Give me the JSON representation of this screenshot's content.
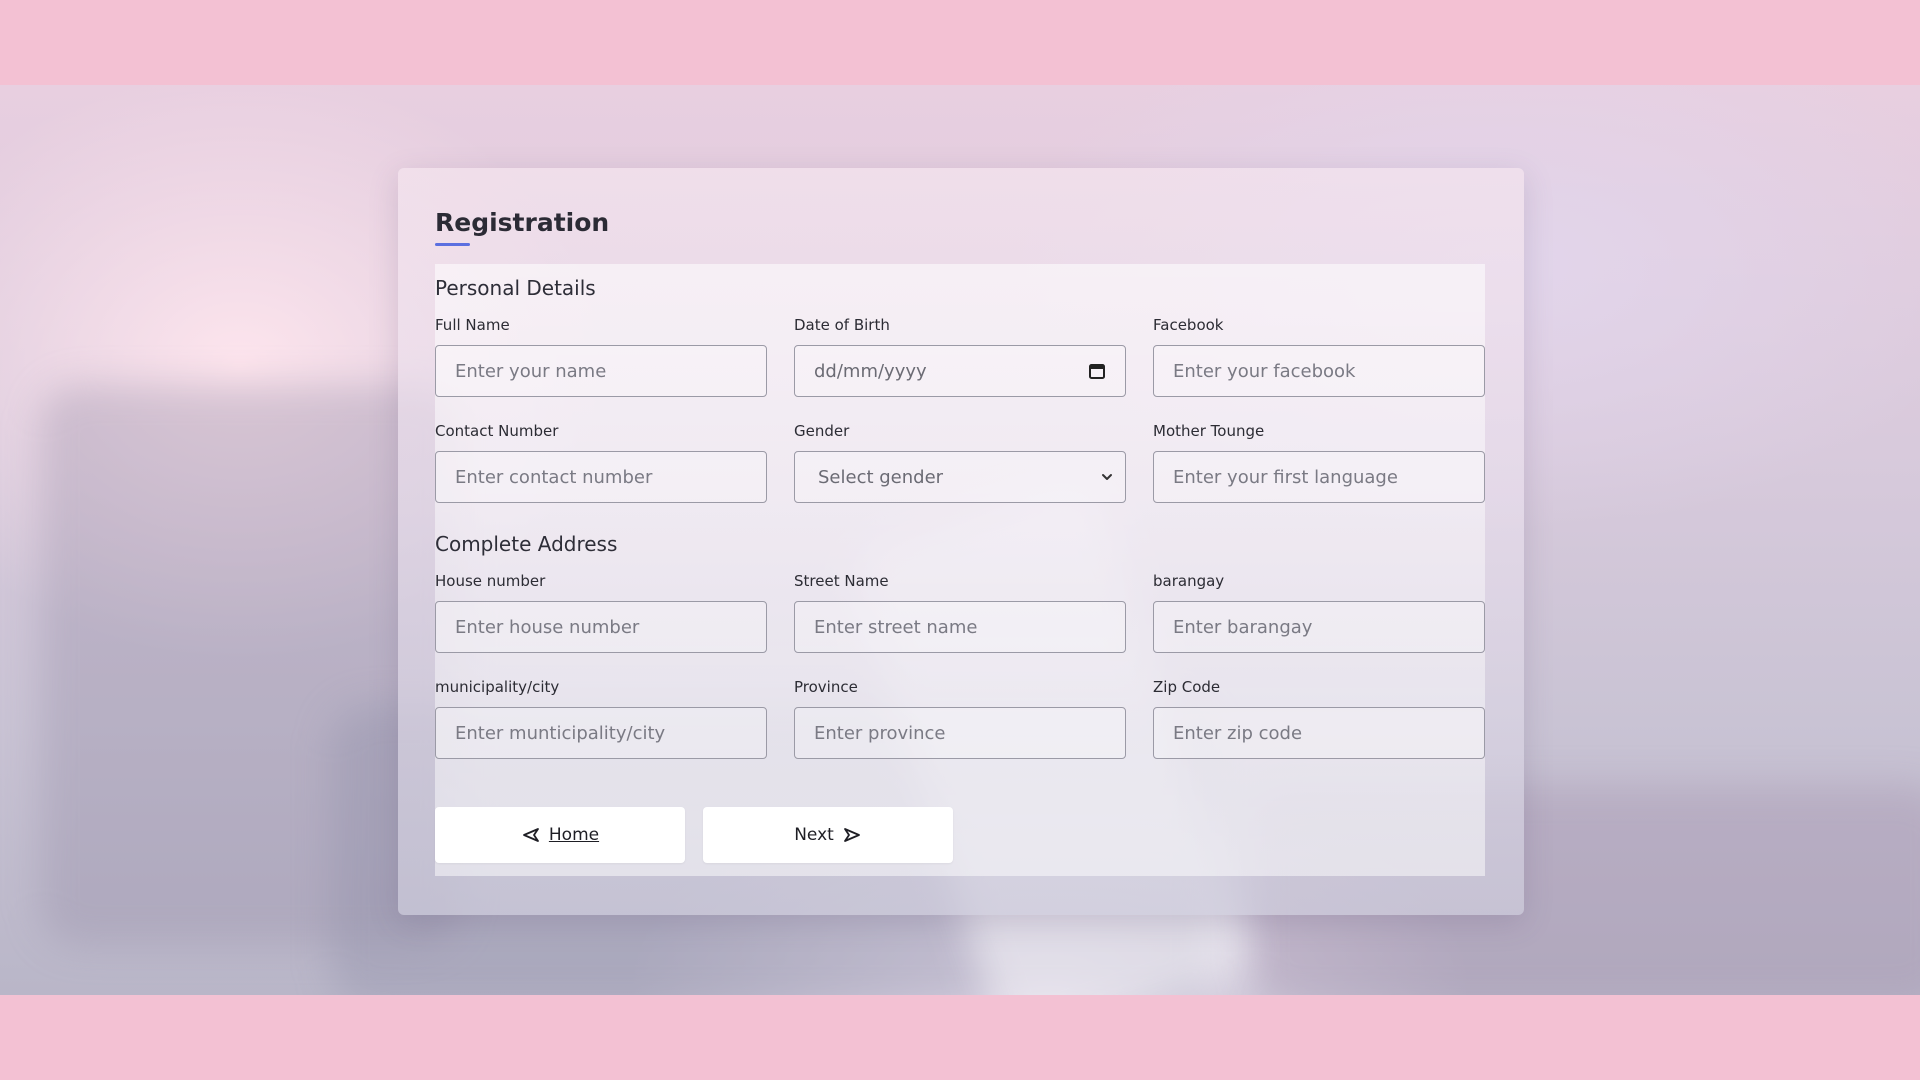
{
  "form": {
    "title": "Registration",
    "accent_color": "#5b6fe0",
    "sections": {
      "personal": "Personal Details",
      "address": "Complete Address"
    },
    "personal_fields": [
      {
        "label": "Full Name",
        "placeholder": "Enter your name"
      },
      {
        "label": "Date of Birth",
        "value": "dd/mm/yyyy"
      },
      {
        "label": "Facebook",
        "placeholder": "Enter your facebook"
      },
      {
        "label": "Contact Number",
        "placeholder": "Enter contact number"
      },
      {
        "label": "Gender",
        "selected": "Select gender"
      },
      {
        "label": "Mother Tounge",
        "placeholder": "Enter your first language"
      }
    ],
    "address_fields": [
      {
        "label": "House number",
        "placeholder": "Enter house number"
      },
      {
        "label": "Street Name",
        "placeholder": "Enter street name"
      },
      {
        "label": "barangay",
        "placeholder": "Enter barangay"
      },
      {
        "label": "municipality/city",
        "placeholder": "Enter munticipality/city"
      },
      {
        "label": "Province",
        "placeholder": "Enter province"
      },
      {
        "label": "Zip Code",
        "placeholder": "Enter zip code"
      }
    ],
    "buttons": {
      "home": "Home",
      "home_icon": "arrow-left-icon",
      "next": "Next",
      "next_icon": "arrow-right-icon"
    }
  },
  "colors": {
    "page_band": "#f3c1d3",
    "input_border": "#9b9aa6",
    "button_bg": "#ffffff"
  }
}
